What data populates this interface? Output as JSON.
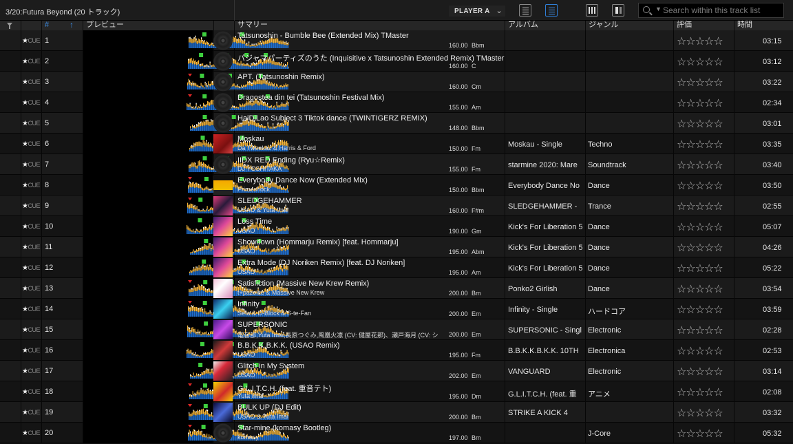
{
  "playlist_title": "3/20:Futura Beyond (20 トラック)",
  "player_selector": "PLAYER A",
  "search": {
    "placeholder": "Search within this track list"
  },
  "headers": {
    "number": "#",
    "preview": "プレビュー",
    "summary": "サマリー",
    "album": "アルバム",
    "genre": "ジャンル",
    "rating": "評価",
    "time": "時間"
  },
  "cue_label": "CUE",
  "rating_glyphs": "☆☆☆☆☆",
  "colors": {
    "accent": "#3d8fe8",
    "wave_low": "#1f6fd0",
    "wave_high": "#f2b33a",
    "wave_peak": "#ffffff",
    "marker_green": "#3ecf3e",
    "marker_red": "#e02828"
  },
  "tracks": [
    {
      "no": "1",
      "title": "Tatsunoshin - Bumble Bee (Extended Mix) TMaster",
      "artist": "",
      "bpm": "160.00",
      "key": "Bbm",
      "album": "",
      "genre": "",
      "time": "03:15",
      "art": "disc"
    },
    {
      "no": "2",
      "title": "パジャマパーティズのうた (Inquisitive x Tatsunoshin Extended Remix) TMaster",
      "artist": "",
      "bpm": "160.00",
      "key": "C",
      "album": "",
      "genre": "",
      "time": "03:12",
      "art": "disc"
    },
    {
      "no": "3",
      "title": "APT. (Tatsunoshin Remix)",
      "artist": "",
      "bpm": "160.00",
      "key": "Cm",
      "album": "",
      "genre": "",
      "time": "03:22",
      "art": "disc"
    },
    {
      "no": "4",
      "title": "Dragostea din tei (Tatsunoshin Festival Mix)",
      "artist": "",
      "bpm": "155.00",
      "key": "Am",
      "album": "",
      "genre": "",
      "time": "02:34",
      "art": "disc"
    },
    {
      "no": "5",
      "title": "HaiDiLao Subject 3 Tiktok dance (TWINTIGERZ REMIX)",
      "artist": "",
      "bpm": "148.00",
      "key": "Bbm",
      "album": "",
      "genre": "",
      "time": "03:01",
      "art": "disc"
    },
    {
      "no": "6",
      "title": "Moskau",
      "artist": "Da Tweekaz & Harris & Ford",
      "bpm": "150.00",
      "key": "Fm",
      "album": "Moskau - Single",
      "genre": "Techno",
      "time": "03:35",
      "art": "red"
    },
    {
      "no": "7",
      "title": "IIDX RED Ending (Ryu☆Remix)",
      "artist": "DJ YOSHITAKA",
      "bpm": "155.00",
      "key": "Fm",
      "album": "starmine 2020: Mare",
      "genre": "Soundtrack",
      "time": "03:40",
      "art": "disc"
    },
    {
      "no": "8",
      "title": "Everybody Dance Now (Extended Mix)",
      "artist": "Primeshock",
      "bpm": "150.00",
      "key": "Bbm",
      "album": "Everybody Dance No",
      "genre": "Dance",
      "time": "03:50",
      "art": "dance"
    },
    {
      "no": "9",
      "title": "SLEDGEHAMMER",
      "artist": "USAO & Yuta Imai",
      "bpm": "160.00",
      "key": "F#m",
      "album": "SLEDGEHAMMER -",
      "genre": "Trance",
      "time": "02:55",
      "art": "pink"
    },
    {
      "no": "10",
      "title": "Loss Time",
      "artist": "USAO",
      "bpm": "190.00",
      "key": "Gm",
      "album": "Kick's For Liberation 5",
      "genre": "Dance",
      "time": "05:07",
      "art": "kick"
    },
    {
      "no": "11",
      "title": "Showdown (Hommarju Remix) [feat. Hommarju]",
      "artist": "USAO",
      "bpm": "195.00",
      "key": "Abm",
      "album": "Kick's For Liberation 5",
      "genre": "Dance",
      "time": "04:26",
      "art": "kick"
    },
    {
      "no": "12",
      "title": "Extra Mode (DJ Noriken Remix) [feat. DJ Noriken]",
      "artist": "USAO",
      "bpm": "195.00",
      "key": "Am",
      "album": "Kick's For Liberation 5",
      "genre": "Dance",
      "time": "05:22",
      "art": "kick"
    },
    {
      "no": "13",
      "title": "Satisfiction (Massive New Krew Remix)",
      "artist": "t+pazolite & Massive New Krew",
      "bpm": "200.00",
      "key": "Bm",
      "album": "Ponko2 Girlish",
      "genre": "Dance",
      "time": "03:54",
      "art": "girl"
    },
    {
      "no": "14",
      "title": "Infinity",
      "artist": "Sefa & D-Block & S-te-Fan",
      "bpm": "200.00",
      "key": "Em",
      "album": "Infinity - Single",
      "genre": "ハードコア",
      "time": "03:59",
      "art": "blue"
    },
    {
      "no": "15",
      "title": "SUPERSONIC",
      "artist": "電音部,Yuta Imai,長原つぐみ,風凰火凛 (CV: 健屋花那)、瀬戸海月 (CV: シ",
      "bpm": "200.00",
      "key": "Em",
      "album": "SUPERSONIC - Singl",
      "genre": "Electronic",
      "time": "02:28",
      "art": "purple"
    },
    {
      "no": "16",
      "title": "B.B.K.K.B.K.K. (USAO Remix)",
      "artist": "USAO",
      "bpm": "195.00",
      "key": "Fm",
      "album": "B.B.K.K.B.K.K. 10TH",
      "genre": "Electronica",
      "time": "02:53",
      "art": "dark"
    },
    {
      "no": "17",
      "title": "Glitch in My System",
      "artist": "USAO",
      "bpm": "202.00",
      "key": "Em",
      "album": "VANGUARD",
      "genre": "Electronic",
      "time": "03:14",
      "art": "redgirl"
    },
    {
      "no": "18",
      "title": "G.L.I.T.C.H. (feat. 重音テト)",
      "artist": "Yuta Imai",
      "bpm": "195.00",
      "key": "Dm",
      "album": "G.L.I.T.C.H. (feat. 重",
      "genre": "アニメ",
      "time": "02:08",
      "art": "yellow"
    },
    {
      "no": "19",
      "title": "BULK UP (DJ Edit)",
      "artist": "USAO & Yuta Imai",
      "bpm": "200.00",
      "key": "Bm",
      "album": "STRIKE A KICK 4",
      "genre": "",
      "time": "03:32",
      "art": "navy"
    },
    {
      "no": "20",
      "title": "Star-mine (komasy Bootleg)",
      "artist": "komasy",
      "bpm": "197.00",
      "key": "Bm",
      "album": "",
      "genre": "J-Core",
      "time": "05:32",
      "art": "disc"
    }
  ]
}
